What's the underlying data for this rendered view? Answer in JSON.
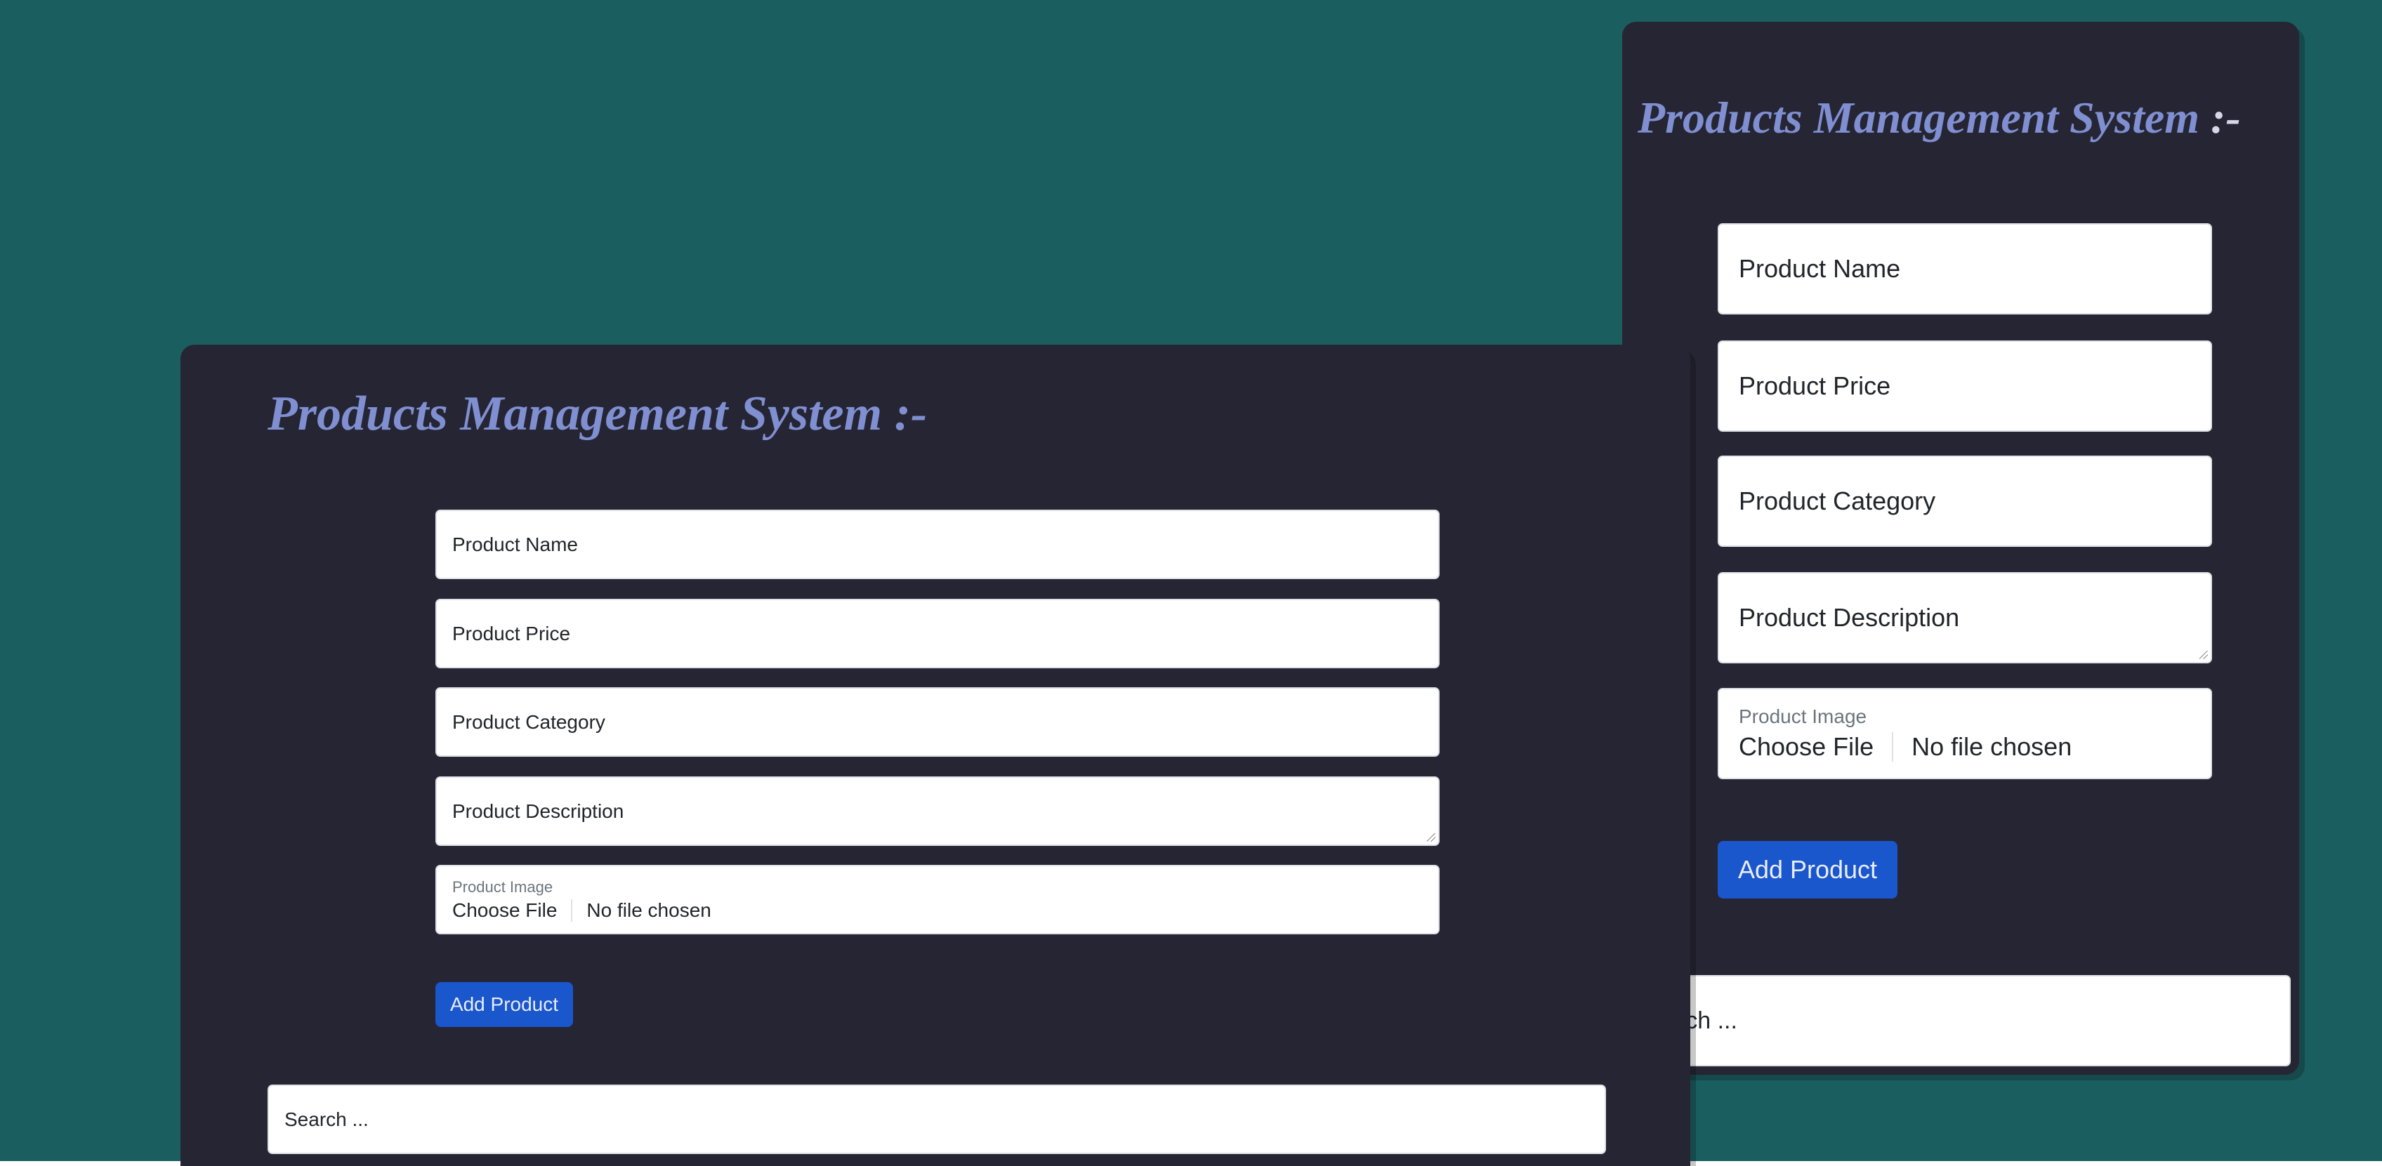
{
  "app": {
    "title_main": "Products Management System ",
    "title_suffix": ":-"
  },
  "colors": {
    "page_background": "#1b5e60",
    "card_background": "#262533",
    "title_color": "#7f8fd1",
    "button_color": "#1a56cc"
  },
  "form": {
    "product_name_placeholder": "Product Name",
    "product_price_placeholder": "Product Price",
    "product_category_placeholder": "Product Category",
    "product_description_placeholder": "Product Description",
    "product_image_label": "Product Image",
    "choose_file_label": "Choose File",
    "file_status": "No file chosen",
    "add_button_label": "Add Product"
  },
  "search": {
    "placeholder": "Search ...",
    "placeholder_clipped": "arch ..."
  }
}
